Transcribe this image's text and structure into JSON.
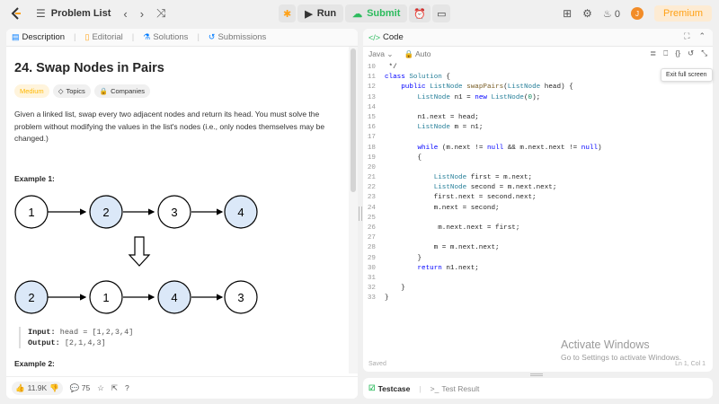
{
  "topbar": {
    "problem_list": "Problem List",
    "run": "Run",
    "submit": "Submit",
    "streak": "0",
    "avatar": "J",
    "premium": "Premium"
  },
  "left": {
    "tabs": [
      "Description",
      "Editorial",
      "Solutions",
      "Submissions"
    ],
    "title": "24. Swap Nodes in Pairs",
    "badges": {
      "difficulty": "Medium",
      "topics": "Topics",
      "companies": "Companies"
    },
    "paragraph": "Given a linked list, swap every two adjacent nodes and return its head. You must solve the problem without modifying the values in the list's nodes (i.e., only nodes themselves may be changed.)",
    "example1": "Example 1:",
    "diagram": {
      "top": [
        "1",
        "2",
        "3",
        "4"
      ],
      "bottom": [
        "2",
        "1",
        "4",
        "3"
      ]
    },
    "input_label": "Input:",
    "input_value": "head = [1,2,3,4]",
    "output_label": "Output:",
    "output_value": "[2,1,4,3]",
    "example2": "Example 2:",
    "likes": "11.9K",
    "comments": "75"
  },
  "right": {
    "code_title": "Code",
    "language": "Java",
    "auto": "Auto",
    "tooltip": "Exit full screen",
    "saved": "Saved",
    "cursor": "Ln 1, Col 1",
    "line_numbers": [
      "10",
      "11",
      "12",
      "13",
      "14",
      "15",
      "16",
      "17",
      "18",
      "19",
      "20",
      "21",
      "22",
      "23",
      "24",
      "25",
      "26",
      "27",
      "28",
      "29",
      "30",
      "31",
      "32",
      "33"
    ],
    "code_lines": [
      " */",
      "class Solution {",
      "    public ListNode swapPairs(ListNode head) {",
      "        ListNode n1 = new ListNode(0);",
      "",
      "        n1.next = head;",
      "        ListNode m = n1;",
      "",
      "        while (m.next != null && m.next.next != null)",
      "        {",
      "",
      "            ListNode first = m.next;",
      "            ListNode second = m.next.next;",
      "            first.next = second.next;",
      "            m.next = second;",
      "",
      "             m.next.next = first;",
      "",
      "            m = m.next.next;",
      "        }",
      "        return n1.next;",
      "",
      "    }",
      "}"
    ]
  },
  "testcase": {
    "tab1": "Testcase",
    "tab2": "Test Result"
  },
  "watermark": {
    "line1": "Activate Windows",
    "line2": "Go to Settings to activate Windows."
  },
  "colors": {
    "accent_green": "#2cbb5d",
    "premium": "#ffa116",
    "node_highlight": "#dbe8f8"
  }
}
